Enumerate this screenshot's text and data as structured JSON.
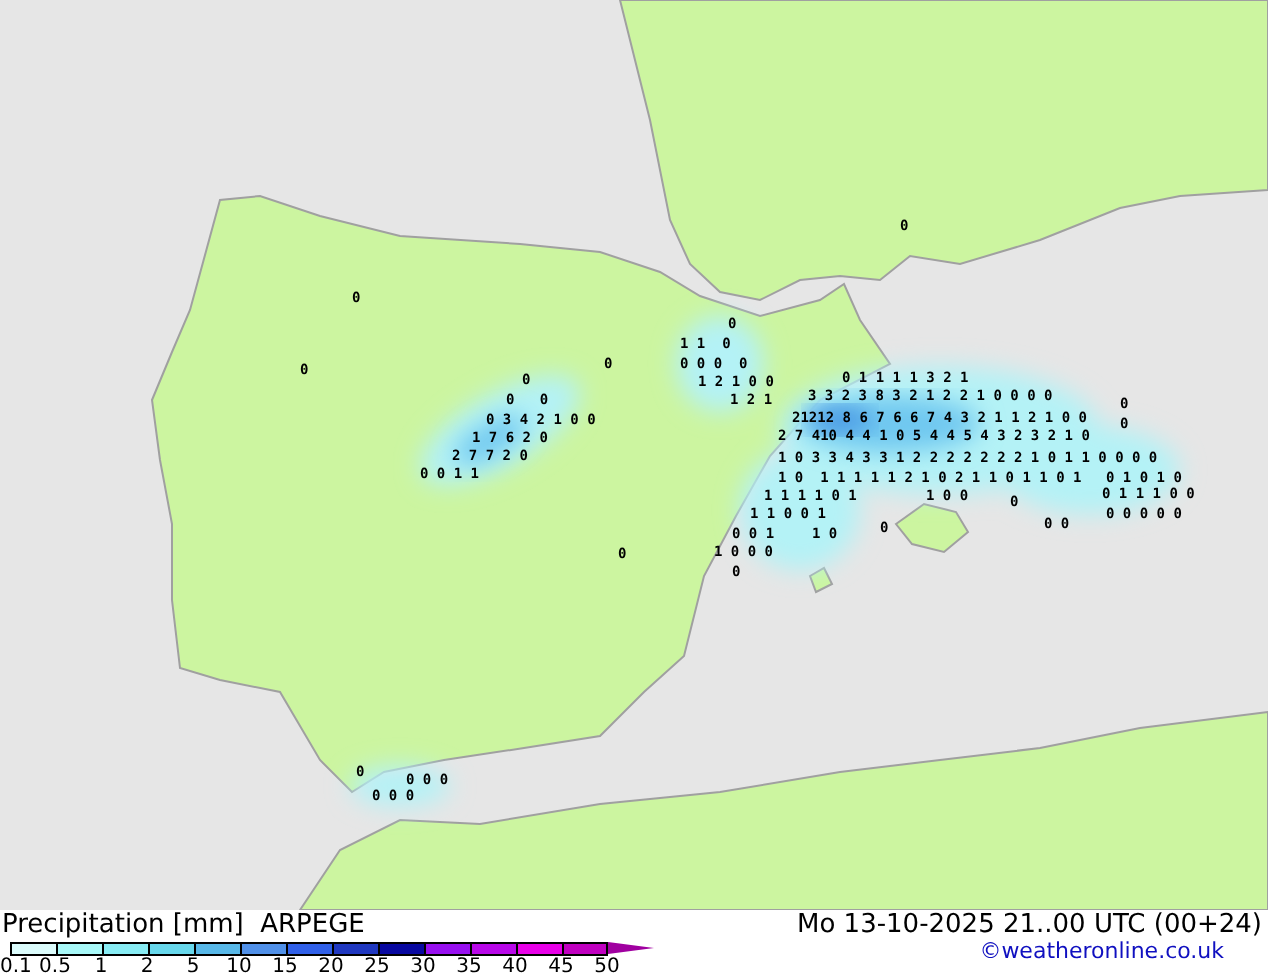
{
  "map": {
    "values": [
      {
        "text": "0"
      },
      {
        "text": "0"
      },
      {
        "text": "0"
      },
      {
        "text": "0"
      },
      {
        "text": "0"
      },
      {
        "text": "0"
      },
      {
        "text": "0   0"
      },
      {
        "text": "0 3 4 2 1 0 0"
      },
      {
        "text": "1 7 6 2 0"
      },
      {
        "text": "2 7 7 2 0"
      },
      {
        "text": "0 0 1 1"
      },
      {
        "text": "0"
      },
      {
        "text": "1 1  0"
      },
      {
        "text": "0 0 0  0"
      },
      {
        "text": "1 2 1 0 0"
      },
      {
        "text": "1 2 1"
      },
      {
        "text": "0 1 1 1 1 3 2 1"
      },
      {
        "text": "3 3 2 3 8 3 2 1 2 2 1 0 0 0 0"
      },
      {
        "text": "21212 8 6 7 6 6 7 4 3 2 1 1 2 1 0 0"
      },
      {
        "text": "2 7 410 4 4 1 0 5 4 4 5 4 3 2 3 2 1 0"
      },
      {
        "text": "1 0 3 3 4 3 3 1 2 2 2 2 2 2 2 1 0 1 1 0 0 0 0"
      },
      {
        "text": "1 0  1 1 1 1 1 2 1 0 2 1 1 0 1 1 0 1"
      },
      {
        "text": "1 1 1 1 0 1"
      },
      {
        "text": "1 0 0"
      },
      {
        "text": "1 1 0 0 1"
      },
      {
        "text": "0 0 1"
      },
      {
        "text": "1 0"
      },
      {
        "text": "1 0 0 0"
      },
      {
        "text": "0"
      },
      {
        "text": "0"
      },
      {
        "text": "0"
      },
      {
        "text": "0 1 0 1 0"
      },
      {
        "text": "0 1 1 1 0 0"
      },
      {
        "text": "0 0 0 0 0"
      },
      {
        "text": "0 0"
      },
      {
        "text": "0"
      },
      {
        "text": "0"
      },
      {
        "text": "0"
      },
      {
        "text": "0 0 0"
      },
      {
        "text": "0 0 0"
      }
    ]
  },
  "footer": {
    "title": "Precipitation [mm]",
    "model": "ARPEGE",
    "valid_time": "Mo 13-10-2025 21..00 UTC (00+24)",
    "credit": "©weatheronline.co.uk"
  },
  "legend": {
    "segments": [
      {
        "color": "#dcfcfc"
      },
      {
        "color": "#a8f8f8"
      },
      {
        "color": "#88ecf4"
      },
      {
        "color": "#68d8ec"
      },
      {
        "color": "#58b8e8"
      },
      {
        "color": "#5090e8"
      },
      {
        "color": "#3060e8"
      },
      {
        "color": "#2038c0"
      },
      {
        "color": "#0808a0"
      },
      {
        "color": "#9810f0"
      },
      {
        "color": "#b808e8"
      },
      {
        "color": "#e800e8"
      },
      {
        "color": "#c000c0"
      },
      {
        "color": "#a000a0"
      }
    ],
    "ticks": [
      "0.1",
      "0.5",
      "1",
      "2",
      "5",
      "10",
      "15",
      "20",
      "25",
      "30",
      "35",
      "40",
      "45",
      "50"
    ]
  }
}
